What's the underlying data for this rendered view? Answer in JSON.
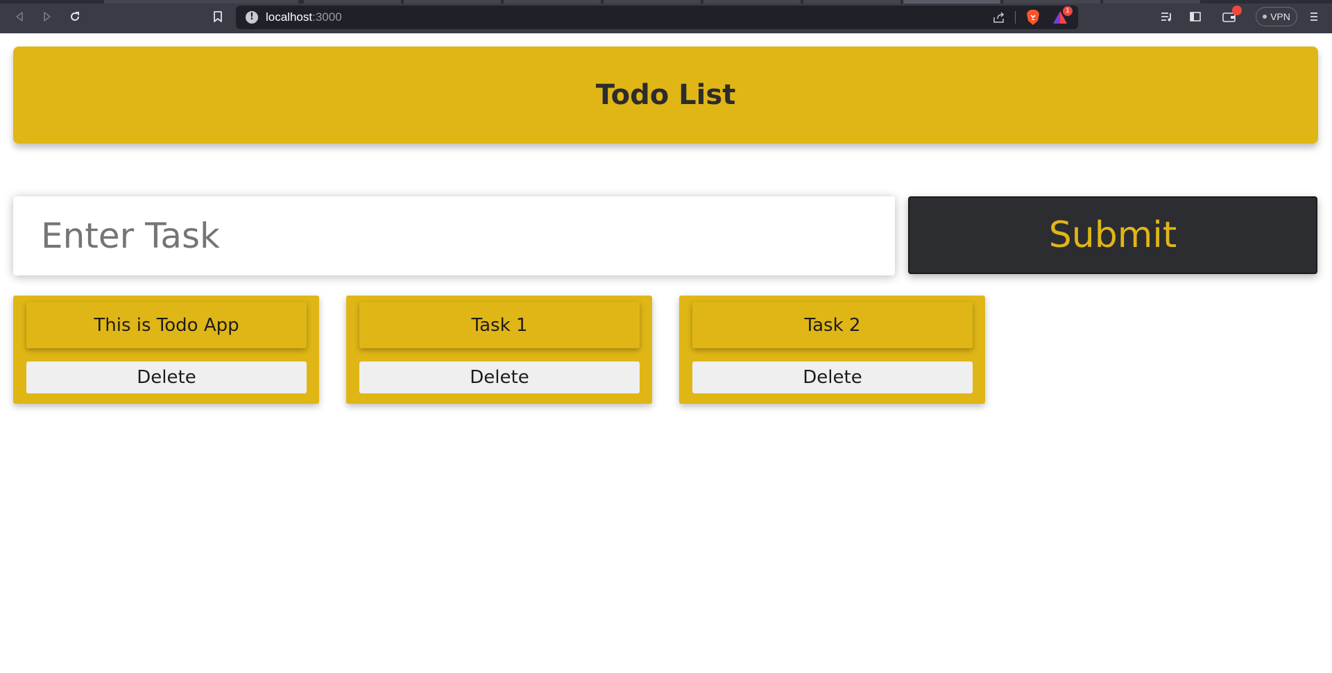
{
  "browser": {
    "url_host": "localhost",
    "url_port": ":3000",
    "vpn_label": "VPN",
    "rewards_badge": "1",
    "icons": {
      "back": "back-arrow-icon",
      "forward": "forward-arrow-icon",
      "reload": "reload-icon",
      "bookmark": "bookmark-icon",
      "site_info": "info-icon",
      "share": "share-icon",
      "brave_shields": "brave-lion-icon",
      "rewards": "rewards-triangle-icon",
      "playlist": "playlist-icon",
      "sidebar": "sidebar-icon",
      "wallet": "wallet-icon",
      "menu": "hamburger-menu-icon"
    }
  },
  "header": {
    "title": "Todo List"
  },
  "form": {
    "input_value": "",
    "input_placeholder": "Enter Task",
    "submit_label": "Submit"
  },
  "tasks": [
    {
      "text": "This is Todo App",
      "delete_label": "Delete"
    },
    {
      "text": "Task 1",
      "delete_label": "Delete"
    },
    {
      "text": "Task 2",
      "delete_label": "Delete"
    }
  ],
  "colors": {
    "accent": "#e0b616",
    "dark_button": "#2c2d31",
    "delete_bg": "#efefef",
    "chrome_bg": "#3a3b45",
    "urlbar_bg": "#1f2028"
  }
}
